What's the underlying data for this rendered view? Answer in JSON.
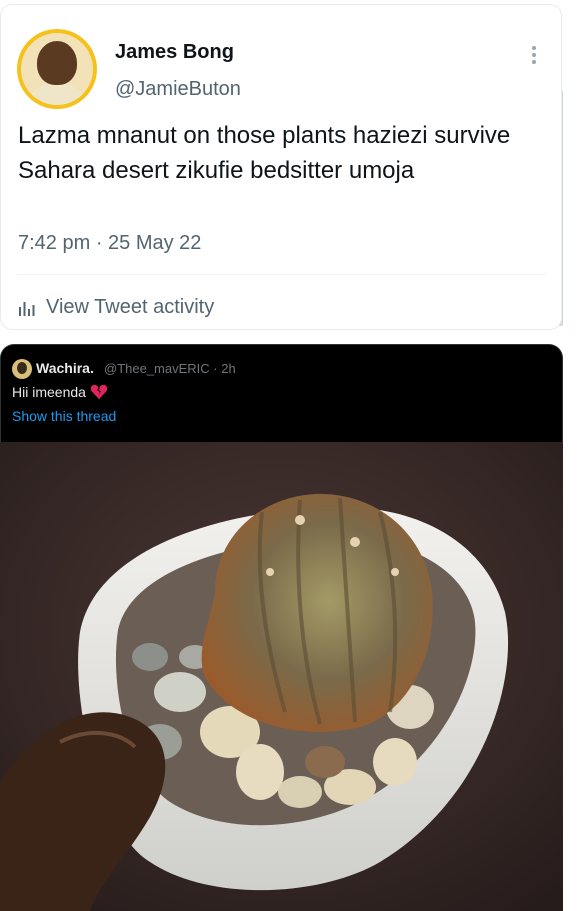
{
  "tweet": {
    "author_name": "James Bong",
    "author_handle": "@JamieButon",
    "text": "Lazma mnanut on those plants haziezi survive Sahara desert zikufie bedsitter umoja",
    "timestamp": "7:42 pm · 25 May 22",
    "activity_label": "View Tweet activity",
    "more_icon": "more-vertical-icon",
    "activity_icon": "bar-chart-icon"
  },
  "reply": {
    "author_name": "Wachira.",
    "meta": "@Thee_mavERIC · 2h",
    "text": "Hii imeenda",
    "emoji_icon": "broken-heart-icon",
    "thread_link": "Show this thread"
  },
  "colors": {
    "accent_link": "#1d9bf0",
    "avatar_ring": "#f4c21a",
    "broken_heart": "#e0245e"
  }
}
